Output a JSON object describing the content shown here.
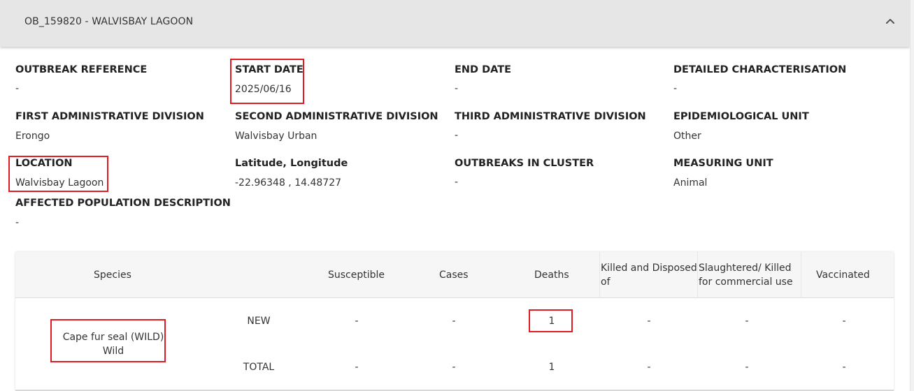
{
  "header": {
    "title": "OB_159820 - WALVISBAY LAGOON",
    "toggle_icon": "chevron-up-icon"
  },
  "fields": {
    "outbreak_reference": {
      "label": "OUTBREAK REFERENCE",
      "value": "-"
    },
    "start_date": {
      "label": "START DATE",
      "value": "2025/06/16"
    },
    "end_date": {
      "label": "END DATE",
      "value": "-"
    },
    "detailed_characterisation": {
      "label": "DETAILED CHARACTERISATION",
      "value": "-"
    },
    "first_admin_division": {
      "label": "FIRST ADMINISTRATIVE DIVISION",
      "value": "Erongo"
    },
    "second_admin_division": {
      "label": "SECOND ADMINISTRATIVE DIVISION",
      "value": "Walvisbay Urban"
    },
    "third_admin_division": {
      "label": "THIRD ADMINISTRATIVE DIVISION",
      "value": "-"
    },
    "epidemiological_unit": {
      "label": "EPIDEMIOLOGICAL UNIT",
      "value": "Other"
    },
    "location": {
      "label": "LOCATION",
      "value": "Walvisbay Lagoon"
    },
    "lat_long": {
      "label": "Latitude, Longitude",
      "value": "-22.96348 , 14.48727"
    },
    "outbreaks_in_cluster": {
      "label": "OUTBREAKS IN CLUSTER",
      "value": "-"
    },
    "measuring_unit": {
      "label": "MEASURING UNIT",
      "value": "Animal"
    },
    "affected_population": {
      "label": "AFFECTED POPULATION DESCRIPTION",
      "value": "-"
    }
  },
  "table": {
    "headers": {
      "species": "Species",
      "susceptible": "Susceptible",
      "cases": "Cases",
      "deaths": "Deaths",
      "killed_disposed": "Killed and Disposed of",
      "slaughtered": "Slaughtered/ Killed for commercial use",
      "vaccinated": "Vaccinated"
    },
    "species": {
      "name": "Cape fur seal (WILD)",
      "type": "Wild"
    },
    "rows": [
      {
        "label": "NEW",
        "susceptible": "-",
        "cases": "-",
        "deaths": "1",
        "killed_disposed": "-",
        "slaughtered": "-",
        "vaccinated": "-"
      },
      {
        "label": "TOTAL",
        "susceptible": "-",
        "cases": "-",
        "deaths": "1",
        "killed_disposed": "-",
        "slaughtered": "-",
        "vaccinated": "-"
      }
    ]
  },
  "colors": {
    "highlight": "#e11b22",
    "header_bg": "#e6e6e6",
    "table_header_bg": "#f6f6f6"
  }
}
